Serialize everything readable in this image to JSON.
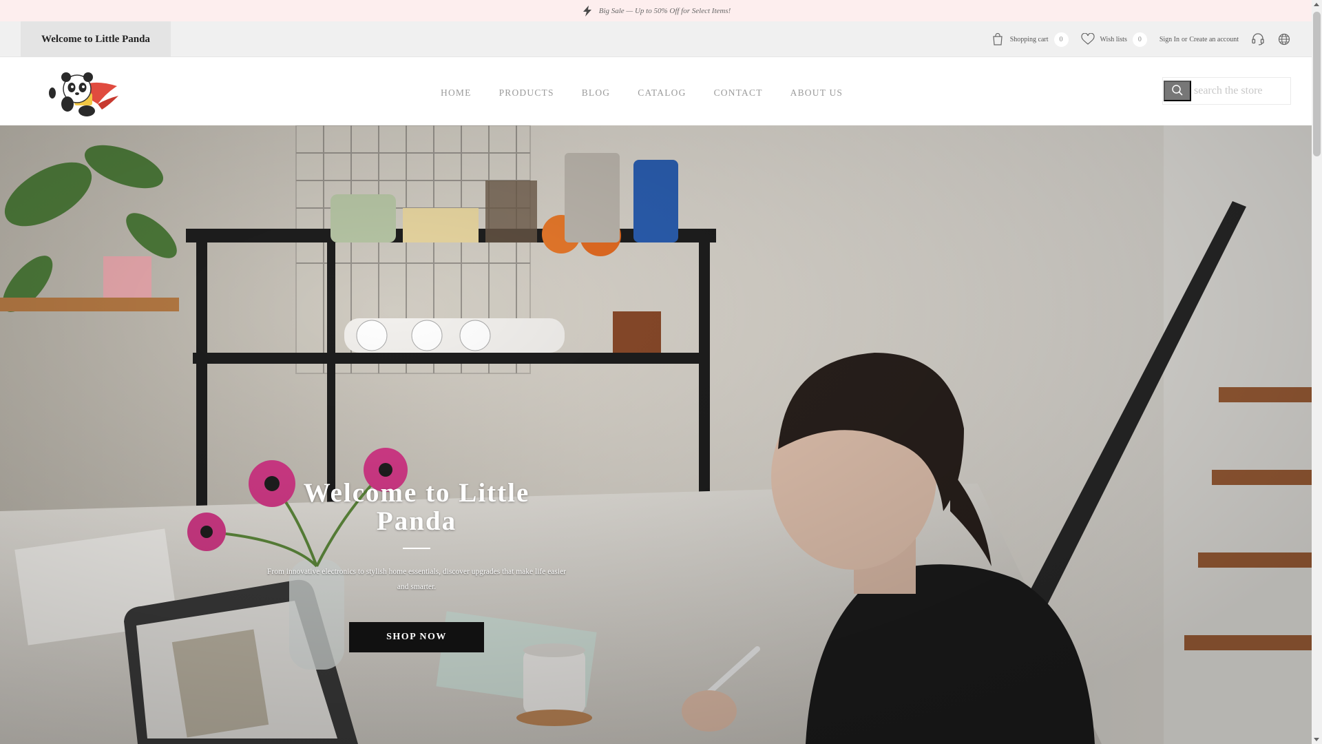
{
  "promo": {
    "icon": "lightning-icon",
    "text": "Big Sale — Up to 50% Off for Select Items!"
  },
  "topbar": {
    "welcome": "Welcome to Little Panda",
    "cart_label": "Shopping cart",
    "cart_count": "0",
    "wishlist_label": "Wish lists",
    "wishlist_count": "0",
    "signin_label": "Sign In",
    "or_text": "or",
    "create_account_label": "Create an account",
    "icons": [
      "cart-icon",
      "heart-icon",
      "headset-icon",
      "globe-icon"
    ]
  },
  "nav": {
    "items": [
      {
        "label": "HOME"
      },
      {
        "label": "PRODUCTS"
      },
      {
        "label": "BLOG"
      },
      {
        "label": "CATALOG"
      },
      {
        "label": "CONTACT"
      },
      {
        "label": "ABOUT US"
      }
    ]
  },
  "search": {
    "placeholder": "search the store"
  },
  "hero": {
    "title": "Welcome to Little Panda",
    "description": "From innovative electronics to stylish home essentials, discover upgrades that make life easier and smarter.",
    "button_label": "SHOP NOW"
  },
  "colors": {
    "promo_bg": "#fdeeee",
    "topbar_bg": "#f0f0f0",
    "button_bg": "#111111",
    "nav_text": "#9a9a9a"
  }
}
